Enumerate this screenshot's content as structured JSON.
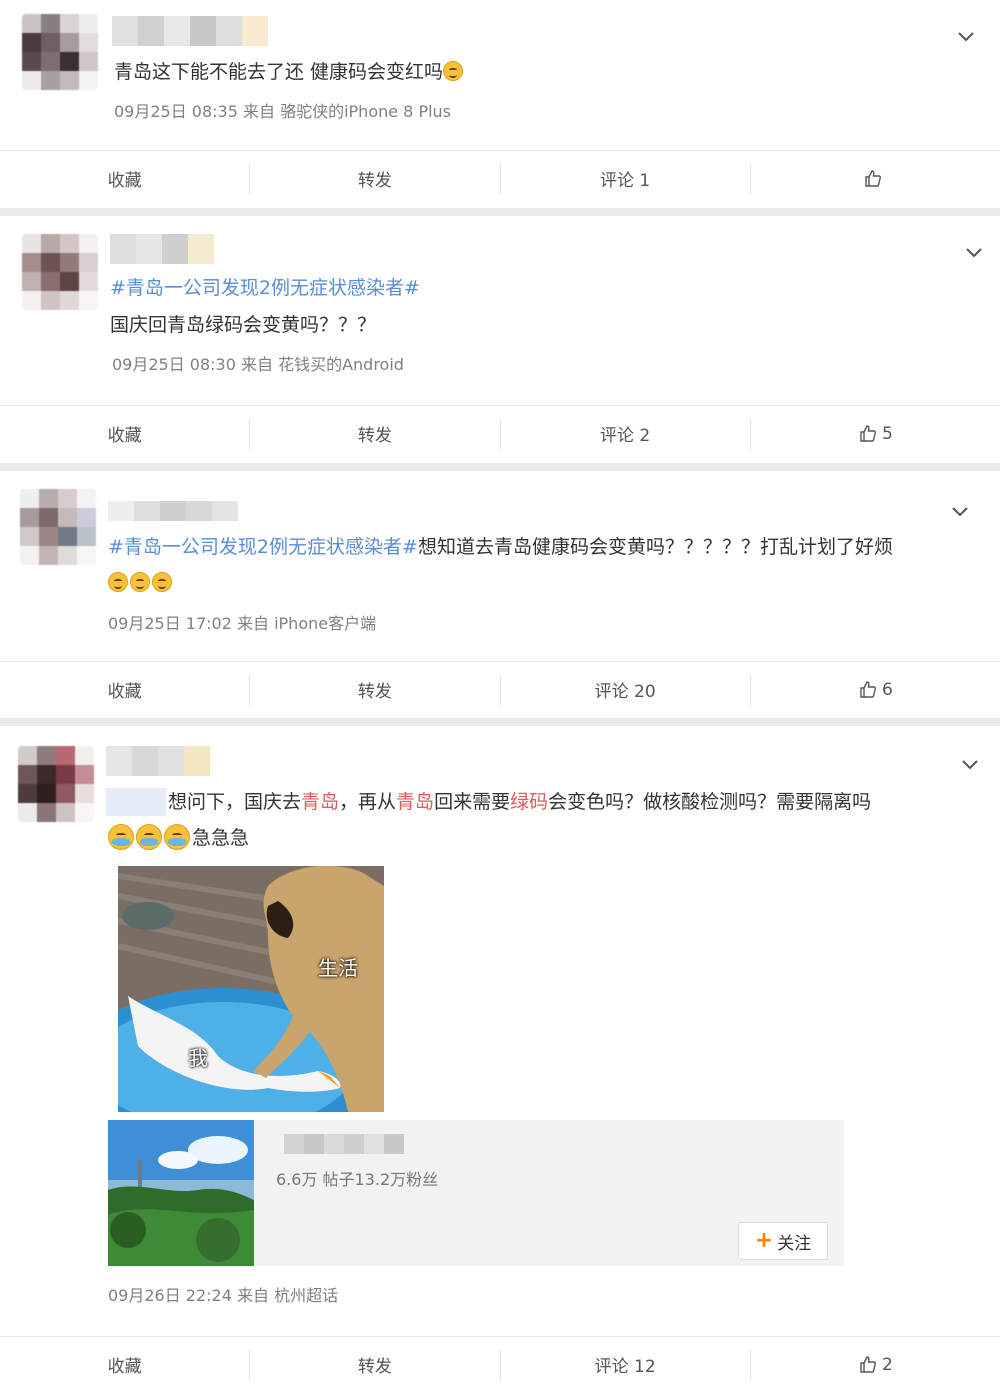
{
  "posts": [
    {
      "text": "青岛这下能不能去了还 健康码会变红吗",
      "meta": "09月25日 08:35  来自 骆驼侠的iPhone 8 Plus",
      "actions": {
        "fav": "收藏",
        "repost": "转发",
        "comment": "评论 1",
        "like": ""
      }
    },
    {
      "topic": "#青岛一公司发现2例无症状感染者#",
      "text": "国庆回青岛绿码会变黄吗？？？",
      "meta": "09月25日 08:30  来自 花钱买的Android",
      "actions": {
        "fav": "收藏",
        "repost": "转发",
        "comment": "评论 2",
        "like": "5"
      }
    },
    {
      "topic": "#青岛一公司发现2例无症状感染者#",
      "text": "想知道去青岛健康码会变黄吗？？？？？打乱计划了好烦",
      "meta": "09月25日 17:02  来自 iPhone客户端",
      "actions": {
        "fav": "收藏",
        "repost": "转发",
        "comment": "评论 20",
        "like": "6"
      }
    },
    {
      "text_parts": [
        "想问下，国庆去",
        "青岛",
        "，再从",
        "青岛",
        "回来需要",
        "绿码",
        "会变色吗？做核酸检测吗？需要隔离吗"
      ],
      "text_line2": "急急急",
      "image_captions": {
        "top": "生活",
        "bottom": "我"
      },
      "supertopic": {
        "stats": "6.6万 帖子13.2万粉丝",
        "follow": "关注"
      },
      "meta": "09月26日 22:24  来自 杭州超话",
      "actions": {
        "fav": "收藏",
        "repost": "转发",
        "comment": "评论 12",
        "like": "2"
      }
    }
  ],
  "colors": {
    "topic": "#5a8dd6",
    "highlight": "#e05a5a",
    "follow_plus": "#ff8200"
  }
}
